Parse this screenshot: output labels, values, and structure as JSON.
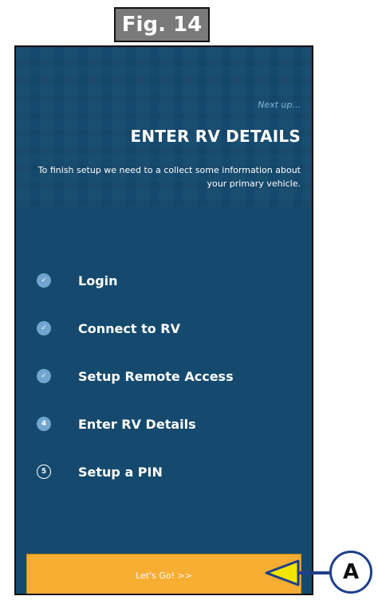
{
  "figure": {
    "label": "Fig. 14"
  },
  "screen": {
    "next_up": "Next up...",
    "title": "ENTER RV DETAILS",
    "description": "To finish setup we need to a collect some information about your primary vehicle.",
    "steps": [
      {
        "badge": "✓",
        "label": "Login",
        "state": "done",
        "icon": "check-icon"
      },
      {
        "badge": "✓",
        "label": "Connect to RV",
        "state": "done",
        "icon": "check-icon"
      },
      {
        "badge": "✓",
        "label": "Setup Remote Access",
        "state": "done",
        "icon": "check-icon"
      },
      {
        "badge": "4",
        "label": "Enter RV Details",
        "state": "current"
      },
      {
        "badge": "5",
        "label": "Setup a PIN",
        "state": "pending"
      }
    ],
    "cta_label": "Let's Go! >>"
  },
  "callout": {
    "letter": "A"
  },
  "colors": {
    "screen_bg": "#154a6e",
    "accent_button": "#f8ad33",
    "step_badge": "#6fa5cf",
    "callout_arrow": "#f2e500",
    "callout_outline": "#1f3f8a"
  }
}
